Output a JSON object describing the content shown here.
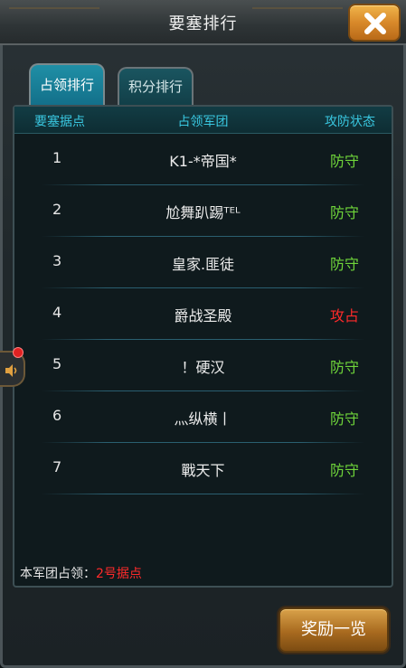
{
  "window": {
    "title": "要塞排行"
  },
  "tabs": [
    {
      "label": "占领排行",
      "active": true
    },
    {
      "label": "积分排行",
      "active": false
    }
  ],
  "table": {
    "headers": [
      "要塞据点",
      "占领军团",
      "攻防状态"
    ],
    "rows": [
      {
        "rank": "1",
        "name": "K1-*帝国*",
        "status": "防守",
        "state": "defend"
      },
      {
        "rank": "2",
        "name": "尬舞趴踢ᵀᴱᴸ",
        "status": "防守",
        "state": "defend"
      },
      {
        "rank": "3",
        "name": "皇家.匪徒",
        "status": "防守",
        "state": "defend"
      },
      {
        "rank": "4",
        "name": "爵战圣殿",
        "status": "攻占",
        "state": "attack"
      },
      {
        "rank": "5",
        "name": "！硬汉",
        "status": "防守",
        "state": "defend"
      },
      {
        "rank": "6",
        "name": "灬纵横丨",
        "status": "防守",
        "state": "defend"
      },
      {
        "rank": "7",
        "name": "戰天下",
        "status": "防守",
        "state": "defend"
      }
    ]
  },
  "footer": {
    "label": "本军团占领：",
    "value": "2号据点"
  },
  "buttons": {
    "reward": "奖励一览"
  },
  "colors": {
    "defend": "#6fd53a",
    "attack": "#ff2a2a",
    "header": "#39c7e0",
    "accent": "#d8892a"
  },
  "icons": {
    "close": "close-x-icon",
    "side": "speaker-icon"
  }
}
